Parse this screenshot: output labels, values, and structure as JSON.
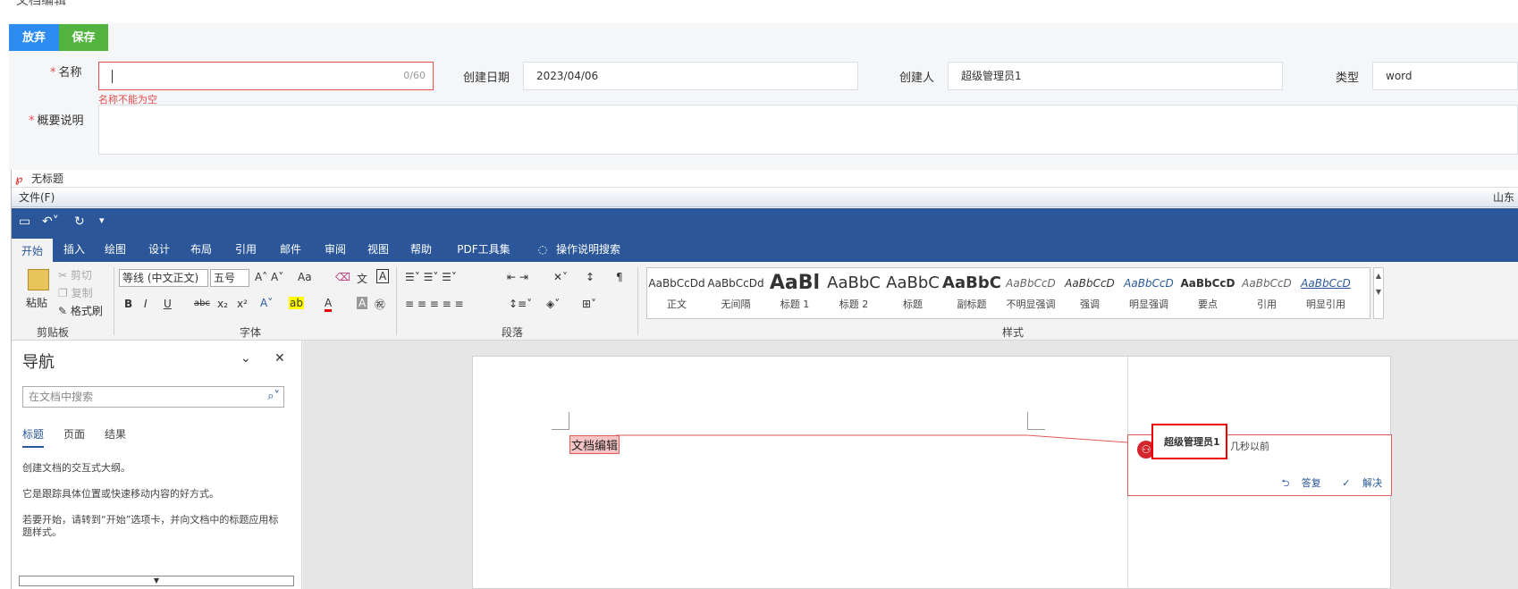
{
  "top_title": "文档编辑",
  "form": {
    "discard_label": "放弃",
    "save_label": "保存",
    "name_label": "名称",
    "name_counter": "0/60",
    "name_error": "名称不能为空",
    "date_label": "创建日期",
    "date_value": "2023/04/06",
    "creator_label": "创建人",
    "creator_value": "超级管理员1",
    "type_label": "类型",
    "type_value": "word",
    "summary_label": "概要说明",
    "required_mark": "*"
  },
  "word": {
    "doc_title": "无标题",
    "menu_file": "文件(F)",
    "menu_right": "山东",
    "tabs": [
      "开始",
      "插入",
      "绘图",
      "设计",
      "布局",
      "引用",
      "邮件",
      "审阅",
      "视图",
      "帮助",
      "PDF工具集",
      "操作说明搜索"
    ],
    "clipboard": {
      "paste": "粘贴",
      "cut": "剪切",
      "copy": "复制",
      "format_painter": "格式刷",
      "group": "剪贴板"
    },
    "font": {
      "font_name": "等线 (中文正文)",
      "font_size": "五号",
      "group": "字体",
      "bold": "B",
      "italic": "I",
      "underline": "U",
      "strike": "abc",
      "sub": "x₂",
      "sup": "x²",
      "change_case": "Aa"
    },
    "paragraph": {
      "group": "段落"
    },
    "styles": {
      "group": "样式",
      "items": [
        {
          "sample": "AaBbCcDd",
          "name": "正文"
        },
        {
          "sample": "AaBbCcDd",
          "name": "无间隔"
        },
        {
          "sample": "AaBl",
          "name": "标题 1"
        },
        {
          "sample": "AaBbC",
          "name": "标题 2"
        },
        {
          "sample": "AaBbC",
          "name": "标题"
        },
        {
          "sample": "AaBbC",
          "name": "副标题"
        },
        {
          "sample": "AaBbCcD",
          "name": "不明显强调"
        },
        {
          "sample": "AaBbCcD",
          "name": "强调"
        },
        {
          "sample": "AaBbCcD",
          "name": "明显强调"
        },
        {
          "sample": "AaBbCcD",
          "name": "要点"
        },
        {
          "sample": "AaBbCcD",
          "name": "引用"
        },
        {
          "sample": "AaBbCcD",
          "name": "明显引用"
        }
      ]
    },
    "nav": {
      "title": "导航",
      "search_placeholder": "在文档中搜索",
      "tabs": [
        "标题",
        "页面",
        "结果"
      ],
      "text1": "创建文档的交互式大纲。",
      "text2": "它是跟踪具体位置或快速移动内容的好方式。",
      "text3": "若要开始，请转到“开始”选项卡，并向文档中的标题应用标题样式。"
    },
    "document": {
      "text": "文档编辑",
      "comment_author": "超级管理员1",
      "comment_time": "几秒以前",
      "reply": "答复",
      "resolve": "解决"
    }
  },
  "colors": {
    "ribbon_blue": "#2b579a",
    "discard": "#2d8cf0",
    "save": "#52b43e",
    "error": "#e64c4c"
  }
}
